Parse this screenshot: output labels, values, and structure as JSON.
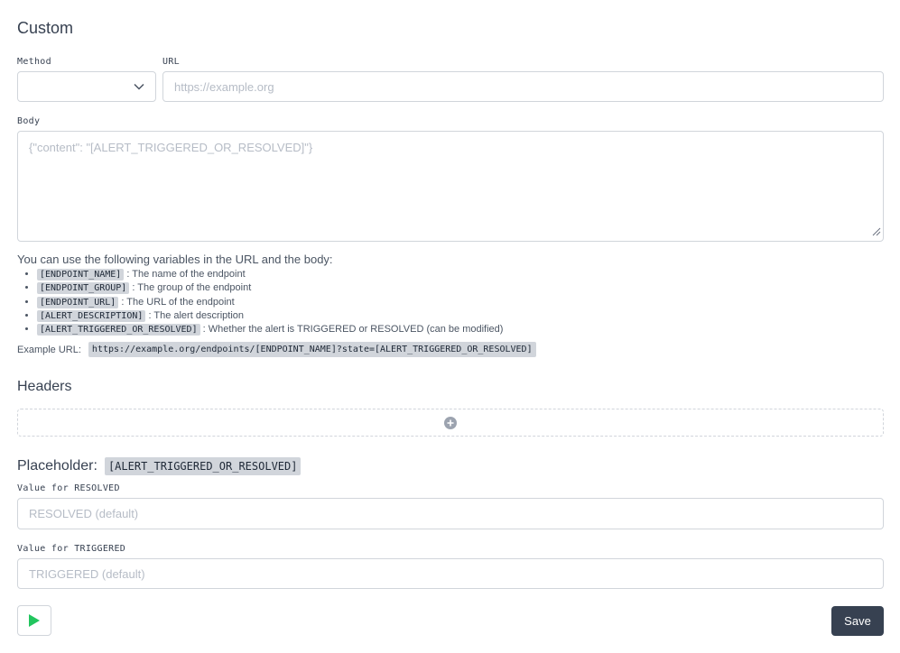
{
  "section_title": "Custom",
  "method": {
    "label": "Method",
    "value": ""
  },
  "url": {
    "label": "URL",
    "placeholder": "https://example.org"
  },
  "body": {
    "label": "Body",
    "placeholder": "{\"content\": \"[ALERT_TRIGGERED_OR_RESOLVED]\"}"
  },
  "variables": {
    "intro": "You can use the following variables in the URL and the body:",
    "items": [
      {
        "code": "[ENDPOINT_NAME]",
        "desc": " : The name of the endpoint"
      },
      {
        "code": "[ENDPOINT_GROUP]",
        "desc": " : The group of the endpoint"
      },
      {
        "code": "[ENDPOINT_URL]",
        "desc": " : The URL of the endpoint"
      },
      {
        "code": "[ALERT_DESCRIPTION]",
        "desc": " : The alert description"
      },
      {
        "code": "[ALERT_TRIGGERED_OR_RESOLVED]",
        "desc": " : Whether the alert is TRIGGERED or RESOLVED (can be modified)"
      }
    ],
    "example_label": "Example URL:",
    "example_value": "https://example.org/endpoints/[ENDPOINT_NAME]?state=[ALERT_TRIGGERED_OR_RESOLVED]"
  },
  "headers": {
    "title": "Headers"
  },
  "placeholder_section": {
    "title": "Placeholder:",
    "code": "[ALERT_TRIGGERED_OR_RESOLVED]",
    "resolved_label_prefix": "Value for ",
    "resolved_label_code": "RESOLVED",
    "resolved_placeholder": "RESOLVED (default)",
    "triggered_label_prefix": "Value for ",
    "triggered_label_code": "TRIGGERED",
    "triggered_placeholder": "TRIGGERED (default)"
  },
  "actions": {
    "save_label": "Save",
    "test_icon": "play-icon"
  },
  "colors": {
    "accent_green": "#22c55e",
    "save_bg": "#374151",
    "code_bg": "#d1d5db"
  }
}
